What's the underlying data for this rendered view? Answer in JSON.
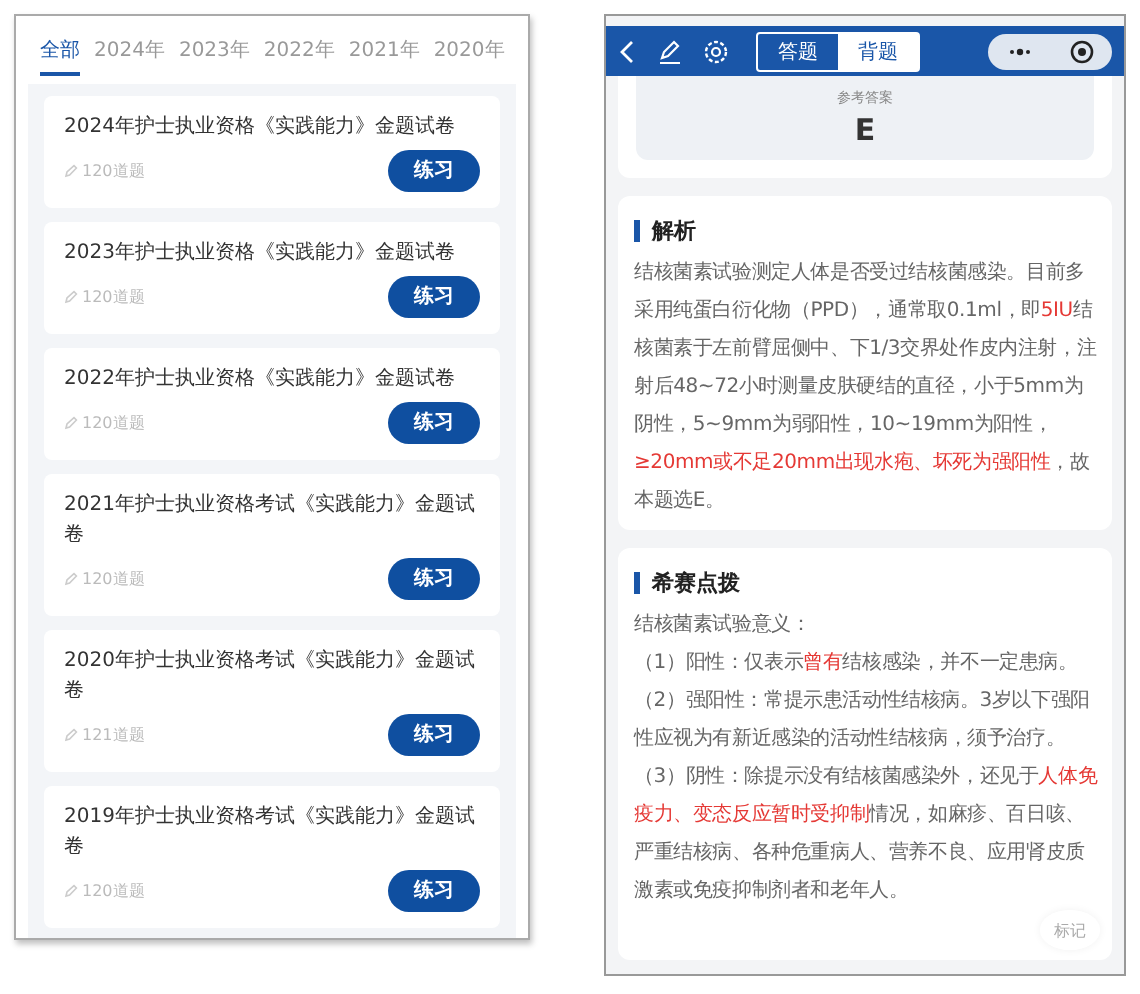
{
  "exam_list": {
    "tabs": [
      {
        "label": "全部",
        "selected": true
      },
      {
        "label": "2024年",
        "selected": false
      },
      {
        "label": "2023年",
        "selected": false
      },
      {
        "label": "2022年",
        "selected": false
      },
      {
        "label": "2021年",
        "selected": false
      },
      {
        "label": "2020年",
        "selected": false
      }
    ],
    "papers": [
      {
        "title": "2024年护士执业资格《实践能力》金题试卷",
        "count": "120道题",
        "button": "练习"
      },
      {
        "title": "2023年护士执业资格《实践能力》金题试卷",
        "count": "120道题",
        "button": "练习"
      },
      {
        "title": "2022年护士执业资格《实践能力》金题试卷",
        "count": "120道题",
        "button": "练习"
      },
      {
        "title": "2021年护士执业资格考试《实践能力》金题试卷",
        "count": "120道题",
        "button": "练习"
      },
      {
        "title": "2020年护士执业资格考试《实践能力》金题试卷",
        "count": "121道题",
        "button": "练习"
      },
      {
        "title": "2019年护士执业资格考试《实践能力》金题试卷",
        "count": "120道题",
        "button": "练习"
      }
    ]
  },
  "question_view": {
    "modes": [
      {
        "label": "答题",
        "selected": false
      },
      {
        "label": "背题",
        "selected": true
      }
    ],
    "answer": {
      "label": "参考答案",
      "value": "E"
    },
    "sections": [
      {
        "title": "解析",
        "paragraphs": [
          [
            {
              "text": "结核菌素试验测定人体是否受过结核菌感染。目前多采用纯蛋白衍化物（PPD），通常取0.1ml，即",
              "highlight": false
            },
            {
              "text": "5IU",
              "highlight": true
            },
            {
              "text": "结核菌素于左前臂屈侧中、下1/3交界处作皮内注射，注射后48~72小时测量皮肤硬结的直径，小于5mm为阴性，5~9mm为弱阳性，10~19mm为阳性，",
              "highlight": false
            },
            {
              "text": "≥20mm或不足20mm出现水疱、坏死为强阳性",
              "highlight": true
            },
            {
              "text": "，故本题选E。",
              "highlight": false
            }
          ]
        ]
      },
      {
        "title": "希赛点拨",
        "paragraphs": [
          [
            {
              "text": "结核菌素试验意义：",
              "highlight": false
            }
          ],
          [
            {
              "text": "（1）阳性：仅表示",
              "highlight": false
            },
            {
              "text": "曾有",
              "highlight": true
            },
            {
              "text": "结核感染，并不一定患病。",
              "highlight": false
            }
          ],
          [
            {
              "text": "（2）强阳性：常提示患活动性结核病。3岁以下强阳性应视为有新近感染的活动性结核病，须予治疗。",
              "highlight": false
            }
          ],
          [
            {
              "text": "（3）阴性：除提示没有结核菌感染外，还见于",
              "highlight": false
            },
            {
              "text": "人体免疫力、变态反应暂时受抑制",
              "highlight": true
            },
            {
              "text": "情况，如麻疹、百日咳、严重结核病、各种危重病人、营养不良、应用肾皮质激素或免疫抑制剂者和老年人。",
              "highlight": false
            }
          ]
        ]
      }
    ],
    "mark_button": "标记"
  }
}
